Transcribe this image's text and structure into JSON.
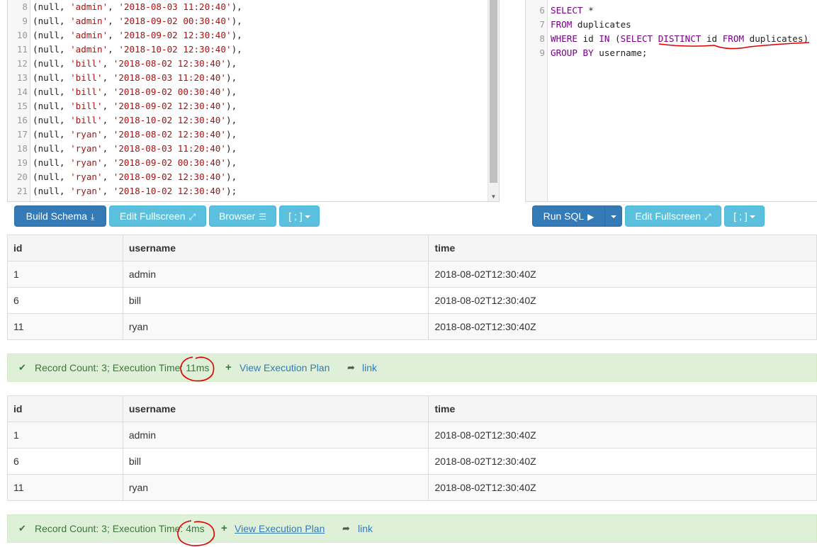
{
  "schema_editor": {
    "lines": [
      {
        "num": "8",
        "user": "'admin'",
        "time": "'2018-08-03 11:20:40'",
        "end": "),"
      },
      {
        "num": "9",
        "user": "'admin'",
        "time": "'2018-09-02 00:30:40'",
        "end": "),"
      },
      {
        "num": "10",
        "user": "'admin'",
        "time": "'2018-09-02 12:30:40'",
        "end": "),"
      },
      {
        "num": "11",
        "user": "'admin'",
        "time": "'2018-10-02 12:30:40'",
        "end": "),"
      },
      {
        "num": "12",
        "user": "'bill'",
        "time": "'2018-08-02 12:30:40'",
        "end": "),"
      },
      {
        "num": "13",
        "user": "'bill'",
        "time": "'2018-08-03 11:20:40'",
        "end": "),"
      },
      {
        "num": "14",
        "user": "'bill'",
        "time": "'2018-09-02 00:30:40'",
        "end": "),"
      },
      {
        "num": "15",
        "user": "'bill'",
        "time": "'2018-09-02 12:30:40'",
        "end": "),"
      },
      {
        "num": "16",
        "user": "'bill'",
        "time": "'2018-10-02 12:30:40'",
        "end": "),"
      },
      {
        "num": "17",
        "user": "'ryan'",
        "time": "'2018-08-02 12:30:40'",
        "end": "),"
      },
      {
        "num": "18",
        "user": "'ryan'",
        "time": "'2018-08-03 11:20:40'",
        "end": "),"
      },
      {
        "num": "19",
        "user": "'ryan'",
        "time": "'2018-09-02 00:30:40'",
        "end": "),"
      },
      {
        "num": "20",
        "user": "'ryan'",
        "time": "'2018-09-02 12:30:40'",
        "end": "),"
      },
      {
        "num": "21",
        "user": "'ryan'",
        "time": "'2018-10-02 12:30:40'",
        "end": ");"
      }
    ],
    "null_token": "(null, ",
    "separator": ", "
  },
  "query_editor": {
    "lines": [
      {
        "num": "6",
        "tokens": [
          {
            "t": "SELECT",
            "k": "kw"
          },
          {
            "t": " *",
            "k": "plain"
          }
        ]
      },
      {
        "num": "7",
        "tokens": [
          {
            "t": "FROM",
            "k": "kw"
          },
          {
            "t": " duplicates",
            "k": "plain"
          }
        ]
      },
      {
        "num": "8",
        "tokens": [
          {
            "t": "WHERE",
            "k": "kw"
          },
          {
            "t": " id ",
            "k": "plain"
          },
          {
            "t": "IN",
            "k": "kw"
          },
          {
            "t": " (",
            "k": "plain"
          },
          {
            "t": "SELECT",
            "k": "kw"
          },
          {
            "t": " ",
            "k": "plain"
          },
          {
            "t": "DISTINCT",
            "k": "kw"
          },
          {
            "t": " id ",
            "k": "plain"
          },
          {
            "t": "FROM",
            "k": "kw"
          },
          {
            "t": " duplicates)",
            "k": "plain"
          }
        ]
      },
      {
        "num": "9",
        "tokens": [
          {
            "t": "GROUP BY",
            "k": "kw"
          },
          {
            "t": " username;",
            "k": "plain"
          }
        ]
      }
    ]
  },
  "schema_toolbar": {
    "build_schema": "Build Schema",
    "edit_fullscreen": "Edit Fullscreen",
    "browser": "Browser",
    "delimiter": "[ ; ]"
  },
  "query_toolbar": {
    "run_sql": "Run SQL",
    "edit_fullscreen": "Edit Fullscreen",
    "delimiter": "[ ; ]"
  },
  "results": [
    {
      "columns": [
        "id",
        "username",
        "time"
      ],
      "rows": [
        [
          "1",
          "admin",
          "2018-08-02T12:30:40Z"
        ],
        [
          "6",
          "bill",
          "2018-08-02T12:30:40Z"
        ],
        [
          "11",
          "ryan",
          "2018-08-02T12:30:40Z"
        ]
      ],
      "status_prefix": "Record Count: 3; Execution Time: ",
      "exec_time": "11ms",
      "view_plan": "View Execution Plan",
      "link": "link"
    },
    {
      "columns": [
        "id",
        "username",
        "time"
      ],
      "rows": [
        [
          "1",
          "admin",
          "2018-08-02T12:30:40Z"
        ],
        [
          "6",
          "bill",
          "2018-08-02T12:30:40Z"
        ],
        [
          "11",
          "ryan",
          "2018-08-02T12:30:40Z"
        ]
      ],
      "status_prefix": "Record Count: 3; Execution Time: ",
      "exec_time": "4ms",
      "view_plan": "View Execution Plan",
      "link": "link"
    }
  ],
  "colors": {
    "primary": "#337ab7",
    "info": "#5bc0de",
    "success_bg": "#dff0d8",
    "annotation": "#e00000"
  }
}
